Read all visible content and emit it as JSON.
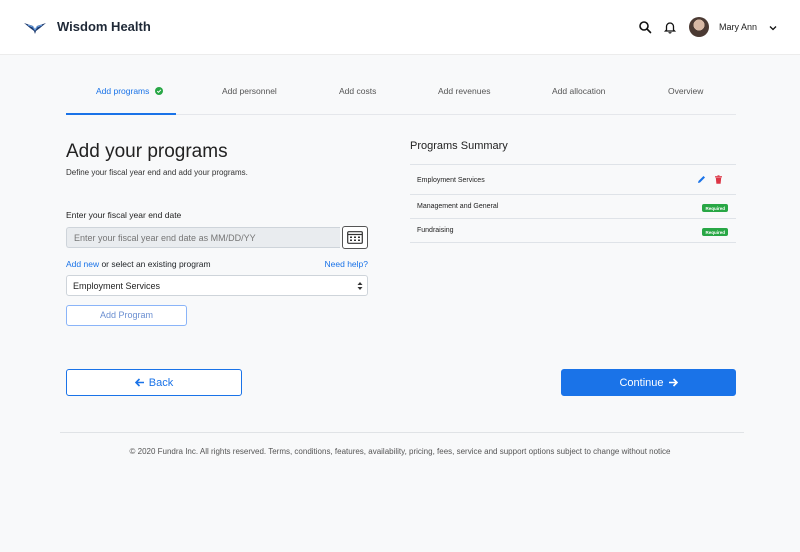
{
  "header": {
    "brand": "Wisdom Health",
    "user_name": "Mary Ann"
  },
  "steps": [
    {
      "label": "Add programs",
      "active": true,
      "completed": true
    },
    {
      "label": "Add personnel"
    },
    {
      "label": "Add costs"
    },
    {
      "label": "Add revenues"
    },
    {
      "label": "Add allocation"
    },
    {
      "label": "Overview"
    }
  ],
  "main": {
    "title": "Add your programs",
    "subtitle": "Define your fiscal year end and add your programs.",
    "fiscal_label": "Enter your fiscal year end date",
    "fiscal_placeholder": "Enter your fiscal year end date as MM/DD/YY",
    "program_label_link": "Add new",
    "program_label_rest": " or select an existing program",
    "need_help": "Need help?",
    "selected_program": "Employment Services",
    "add_program_button": "Add Program"
  },
  "summary": {
    "title": "Programs Summary",
    "rows": [
      {
        "name": "Employment Services",
        "editable": true
      },
      {
        "name": "Management and General",
        "badge": "Required"
      },
      {
        "name": "Fundraising",
        "badge": "Required"
      }
    ]
  },
  "nav": {
    "back": "Back",
    "continue": "Continue"
  },
  "footer": {
    "text": "© 2020 Fundra Inc. All rights reserved. Terms, conditions, features, availability, pricing, fees, service and support options subject to change without notice"
  },
  "colors": {
    "accent": "#1a73e8",
    "success": "#28a745",
    "danger": "#dc3545"
  },
  "icons": {
    "logo": "eagle-logo-icon",
    "search": "search-icon",
    "bell": "bell-icon",
    "caret": "chevron-down-icon",
    "calendar": "calendar-icon",
    "edit": "pencil-icon",
    "delete": "trash-icon",
    "check": "check-circle-icon",
    "back": "arrow-left-icon",
    "forward": "arrow-right-icon"
  }
}
